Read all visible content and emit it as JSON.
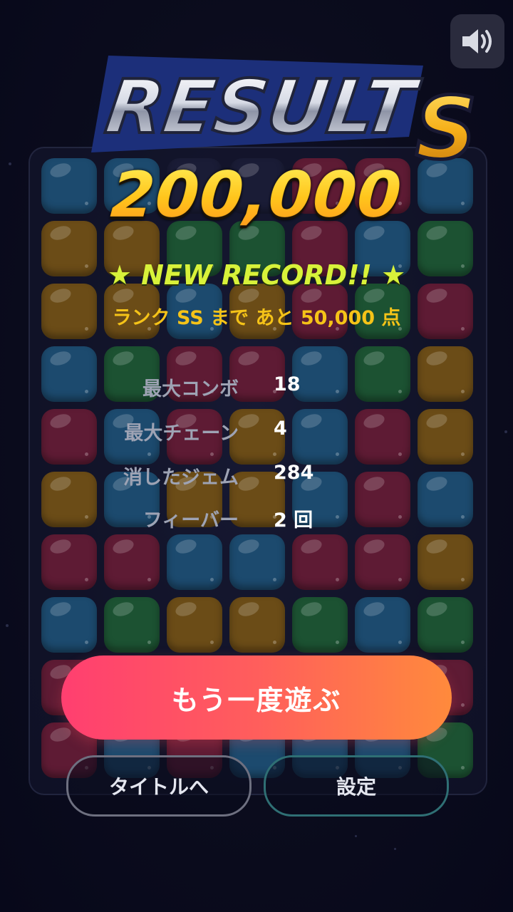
{
  "header": {
    "title": "RESULT",
    "rank": "S",
    "sound_icon": "speaker-volume-icon"
  },
  "score": {
    "value": "200,000",
    "new_record": "★ NEW RECORD!! ★",
    "rank_hint": "ランク SS まで あと 50,000 点"
  },
  "stats": [
    {
      "label": "最大コンボ",
      "value": "18"
    },
    {
      "label": "最大チェーン",
      "value": "4"
    },
    {
      "label": "消したジェム",
      "value": "284"
    },
    {
      "label": "フィーバー",
      "value": "2 回"
    }
  ],
  "buttons": {
    "play_again": "もう一度遊ぶ",
    "to_title": "タイトルへ",
    "settings": "設定"
  },
  "board": {
    "colors": {
      "b": "#1c4a6e",
      "y": "#6b4c17",
      "g": "#1c5232",
      "r": "#5e1b34"
    },
    "rows": [
      "bbnnrrb",
      "yyggrbg",
      "yybyrgr",
      "bgrrbgy",
      "rbrybry",
      "ybyybrb",
      "rrbbrry",
      "bgyygbg",
      "rnnnnnr",
      "rbrbbbg"
    ]
  }
}
